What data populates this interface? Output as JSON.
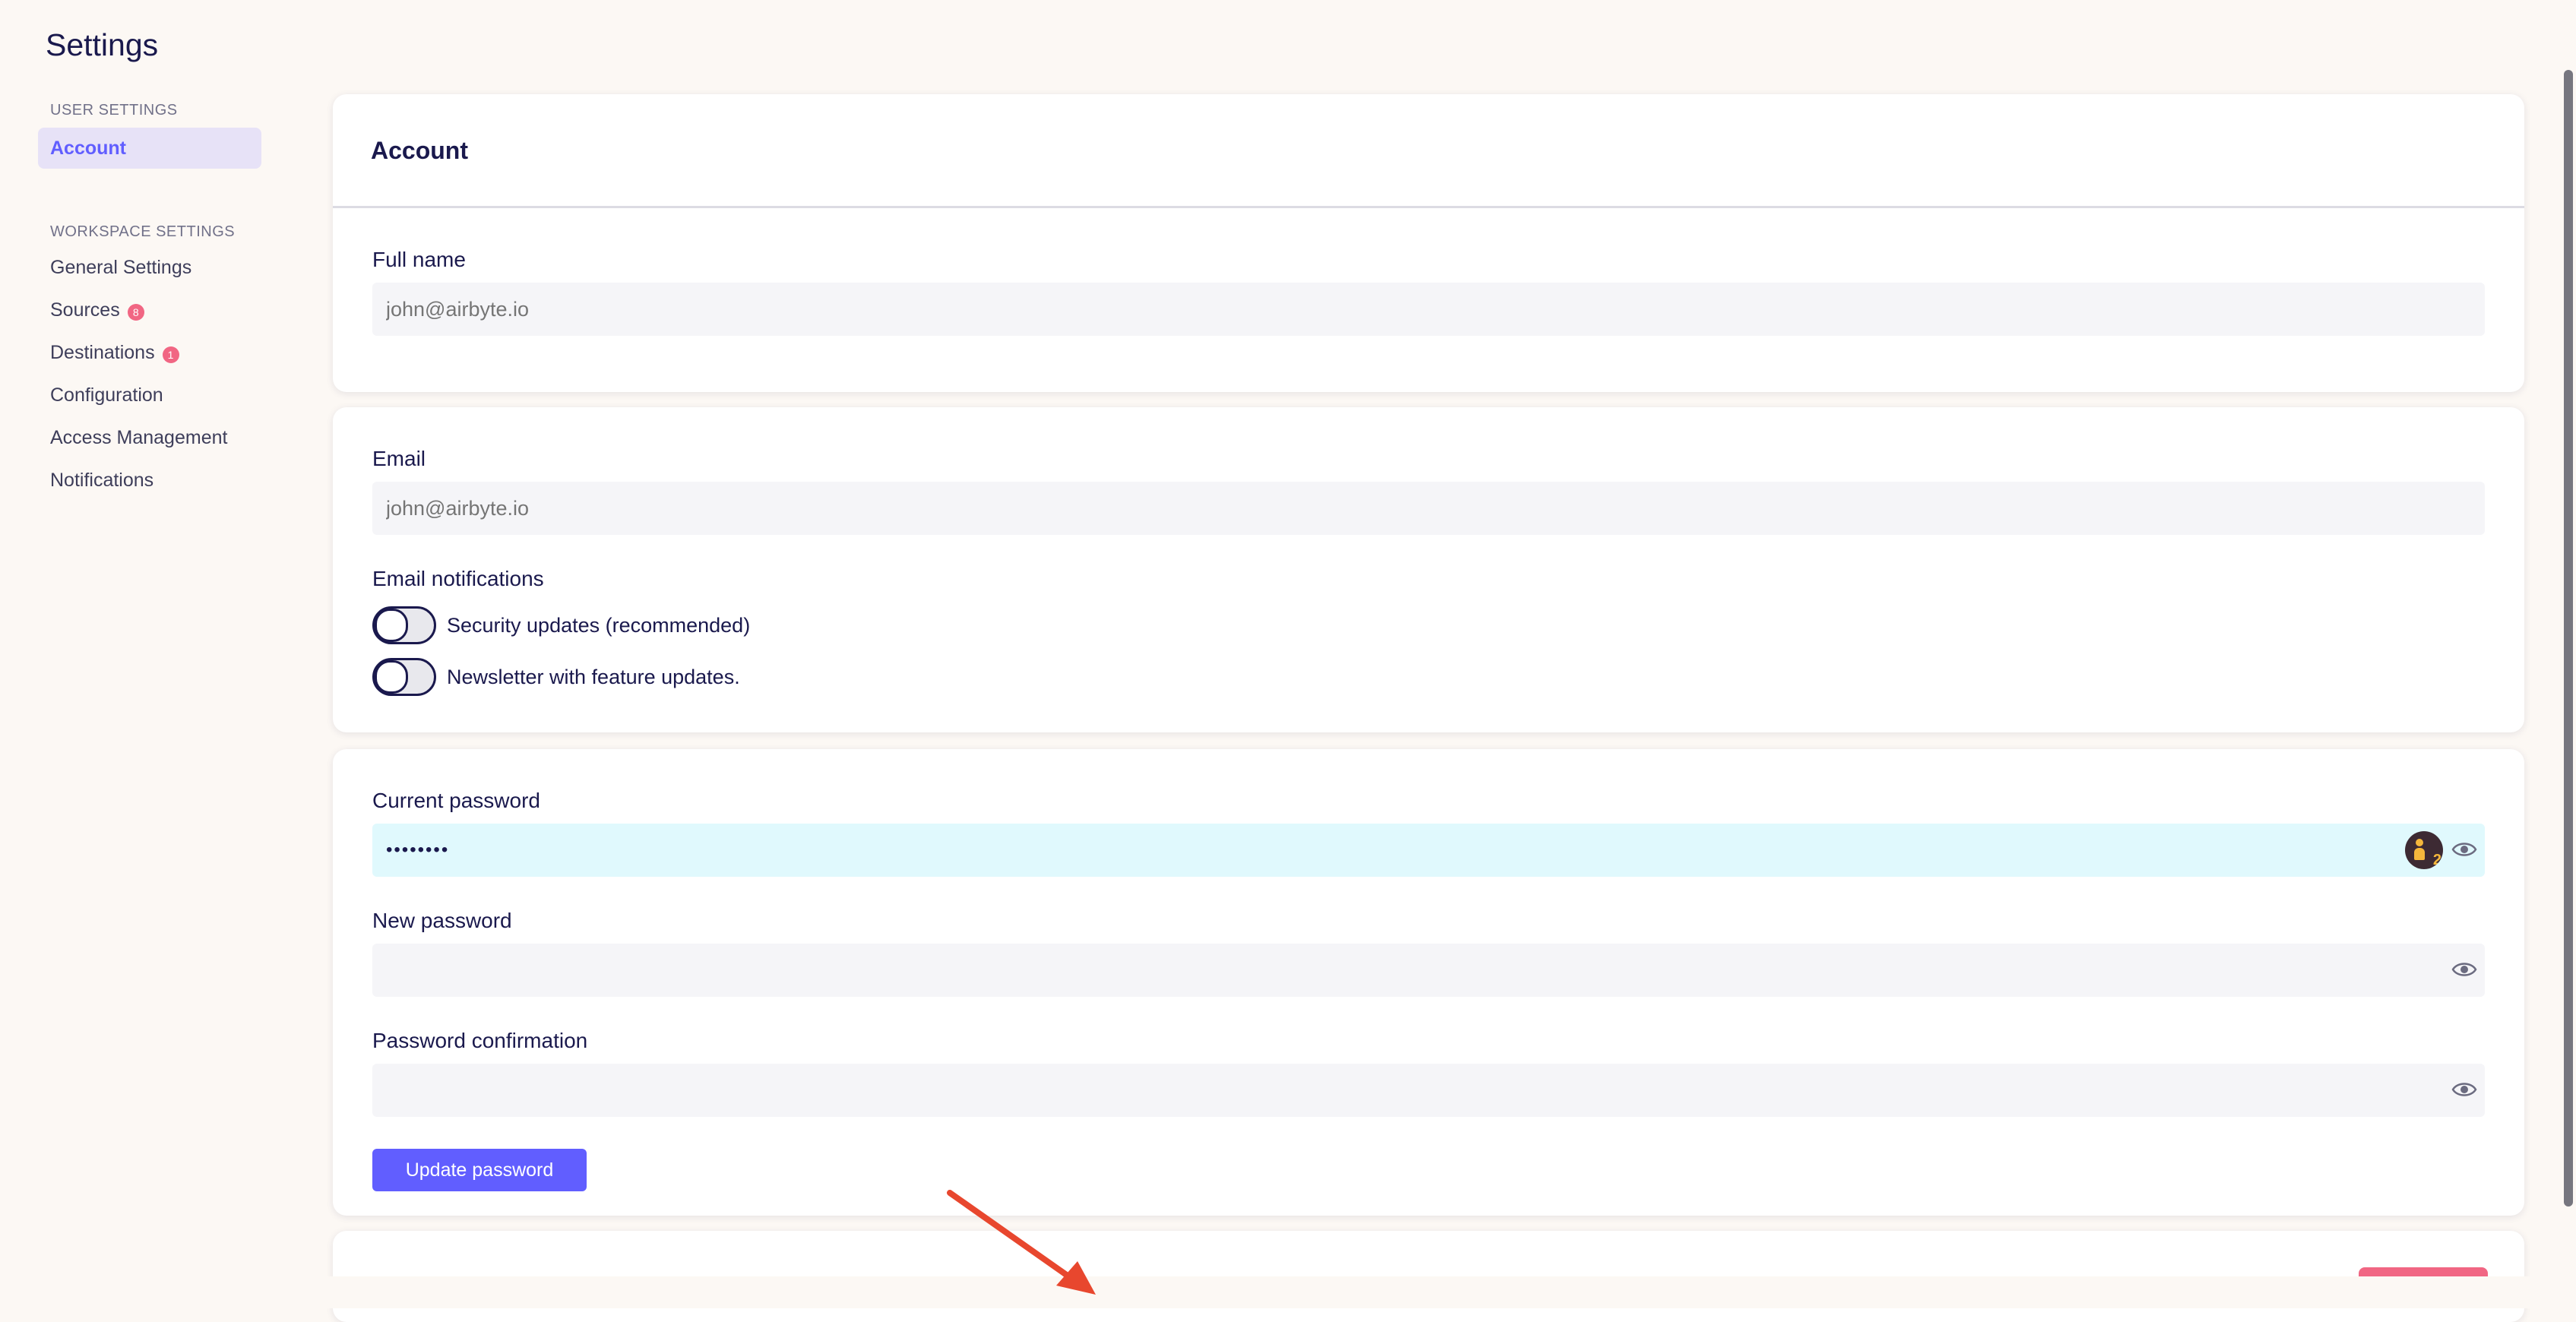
{
  "page": {
    "title": "Settings"
  },
  "sidebar": {
    "user_heading": "USER SETTINGS",
    "active_item": "Account",
    "workspace_heading": "WORKSPACE SETTINGS",
    "items": [
      {
        "label": "General Settings",
        "badge": ""
      },
      {
        "label": "Sources",
        "badge": "8"
      },
      {
        "label": "Destinations",
        "badge": "1"
      },
      {
        "label": "Configuration",
        "badge": ""
      },
      {
        "label": "Access Management",
        "badge": ""
      },
      {
        "label": "Notifications",
        "badge": ""
      }
    ]
  },
  "account": {
    "title": "Account",
    "full_name_label": "Full name",
    "full_name_placeholder": "john@airbyte.io",
    "email_label": "Email",
    "email_placeholder": "john@airbyte.io",
    "email_notifications_label": "Email notifications",
    "toggles": [
      {
        "label": "Security updates (recommended)",
        "on": false
      },
      {
        "label": "Newsletter with feature updates.",
        "on": false
      }
    ],
    "current_password_label": "Current password",
    "current_password_value": "••••••••",
    "new_password_label": "New password",
    "password_confirmation_label": "Password confirmation",
    "update_password_label": "Update password"
  },
  "icons": {
    "eye": "eye-icon",
    "password_manager": "password-manager-avatar-icon",
    "password_manager_count": "2"
  },
  "colors": {
    "accent": "#615eff",
    "badge": "#f16683",
    "focus_input": "#e0f9fd",
    "annotation_arrow": "#e8472e"
  }
}
